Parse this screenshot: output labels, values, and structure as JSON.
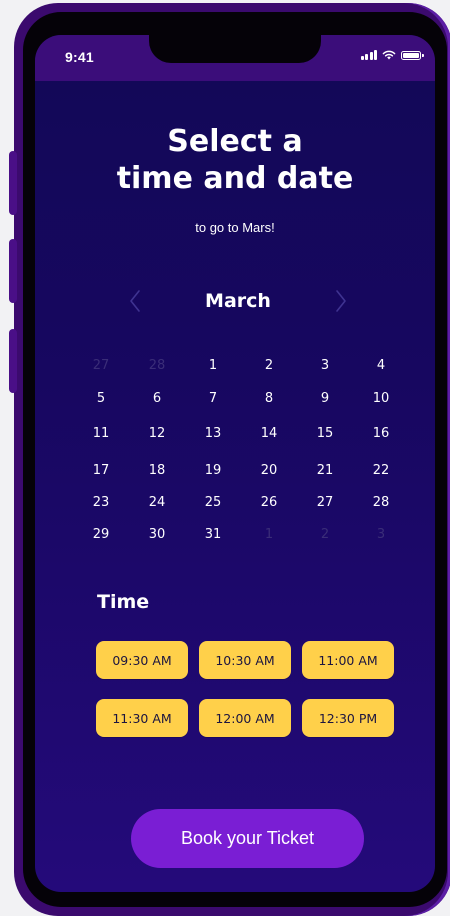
{
  "status_bar": {
    "time": "9:41",
    "icons": [
      "signal-icon",
      "wifi-icon",
      "battery-icon"
    ]
  },
  "header": {
    "title_line1": "Select a",
    "title_line2": "time and date",
    "subtitle": "to go to Mars!"
  },
  "calendar": {
    "month": "March",
    "prev_icon": "chevron-left-icon",
    "next_icon": "chevron-right-icon",
    "weeks": [
      [
        {
          "d": "27",
          "muted": true
        },
        {
          "d": "28",
          "muted": true
        },
        {
          "d": "1"
        },
        {
          "d": "2"
        },
        {
          "d": "3"
        },
        {
          "d": "4"
        }
      ],
      [
        {
          "d": "5"
        },
        {
          "d": "6"
        },
        {
          "d": "7"
        },
        {
          "d": "8"
        },
        {
          "d": "9"
        },
        {
          "d": "10"
        }
      ],
      [
        {
          "d": "11"
        },
        {
          "d": "12"
        },
        {
          "d": "13"
        },
        {
          "d": "14"
        },
        {
          "d": "15"
        },
        {
          "d": "16"
        }
      ],
      [
        {
          "d": "17"
        },
        {
          "d": "18"
        },
        {
          "d": "19"
        },
        {
          "d": "20"
        },
        {
          "d": "21"
        },
        {
          "d": "22"
        }
      ],
      [
        {
          "d": "23"
        },
        {
          "d": "24"
        },
        {
          "d": "25"
        },
        {
          "d": "26"
        },
        {
          "d": "27"
        },
        {
          "d": "28"
        }
      ],
      [
        {
          "d": "29"
        },
        {
          "d": "30"
        },
        {
          "d": "31"
        },
        {
          "d": "1",
          "muted": true
        },
        {
          "d": "2",
          "muted": true
        },
        {
          "d": "3",
          "muted": true
        }
      ]
    ]
  },
  "time_section": {
    "heading": "Time",
    "slots": [
      "09:30 AM",
      "10:30 AM",
      "11:00 AM",
      "11:30 AM",
      "12:00 AM",
      "12:30 PM"
    ]
  },
  "book_button": {
    "label": "Book your Ticket"
  },
  "colors": {
    "frame": "#3b0a6e",
    "background_top": "#120857",
    "background_bottom": "#240a7a",
    "slot": "#ffd04a",
    "button": "#7a1ed4",
    "muted_day": "#3a2d78"
  }
}
